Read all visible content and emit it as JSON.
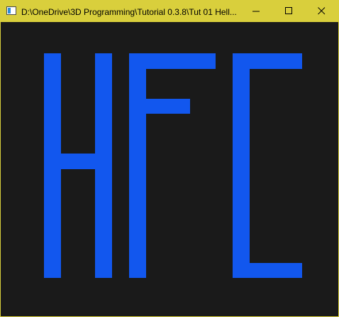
{
  "window": {
    "title": "D:\\OneDrive\\3D Programming\\Tutorial 0.3.8\\Tut 01 Hell..."
  },
  "controls": {
    "minimize_icon": "minimize-icon",
    "maximize_icon": "maximize-icon",
    "close_icon": "close-icon"
  },
  "colors": {
    "titlebar": "#d9cf3c",
    "canvas_background": "#1a1a1a",
    "glyph_fill": "#1257ee"
  },
  "canvas": {
    "rendered_text": "HFC"
  }
}
